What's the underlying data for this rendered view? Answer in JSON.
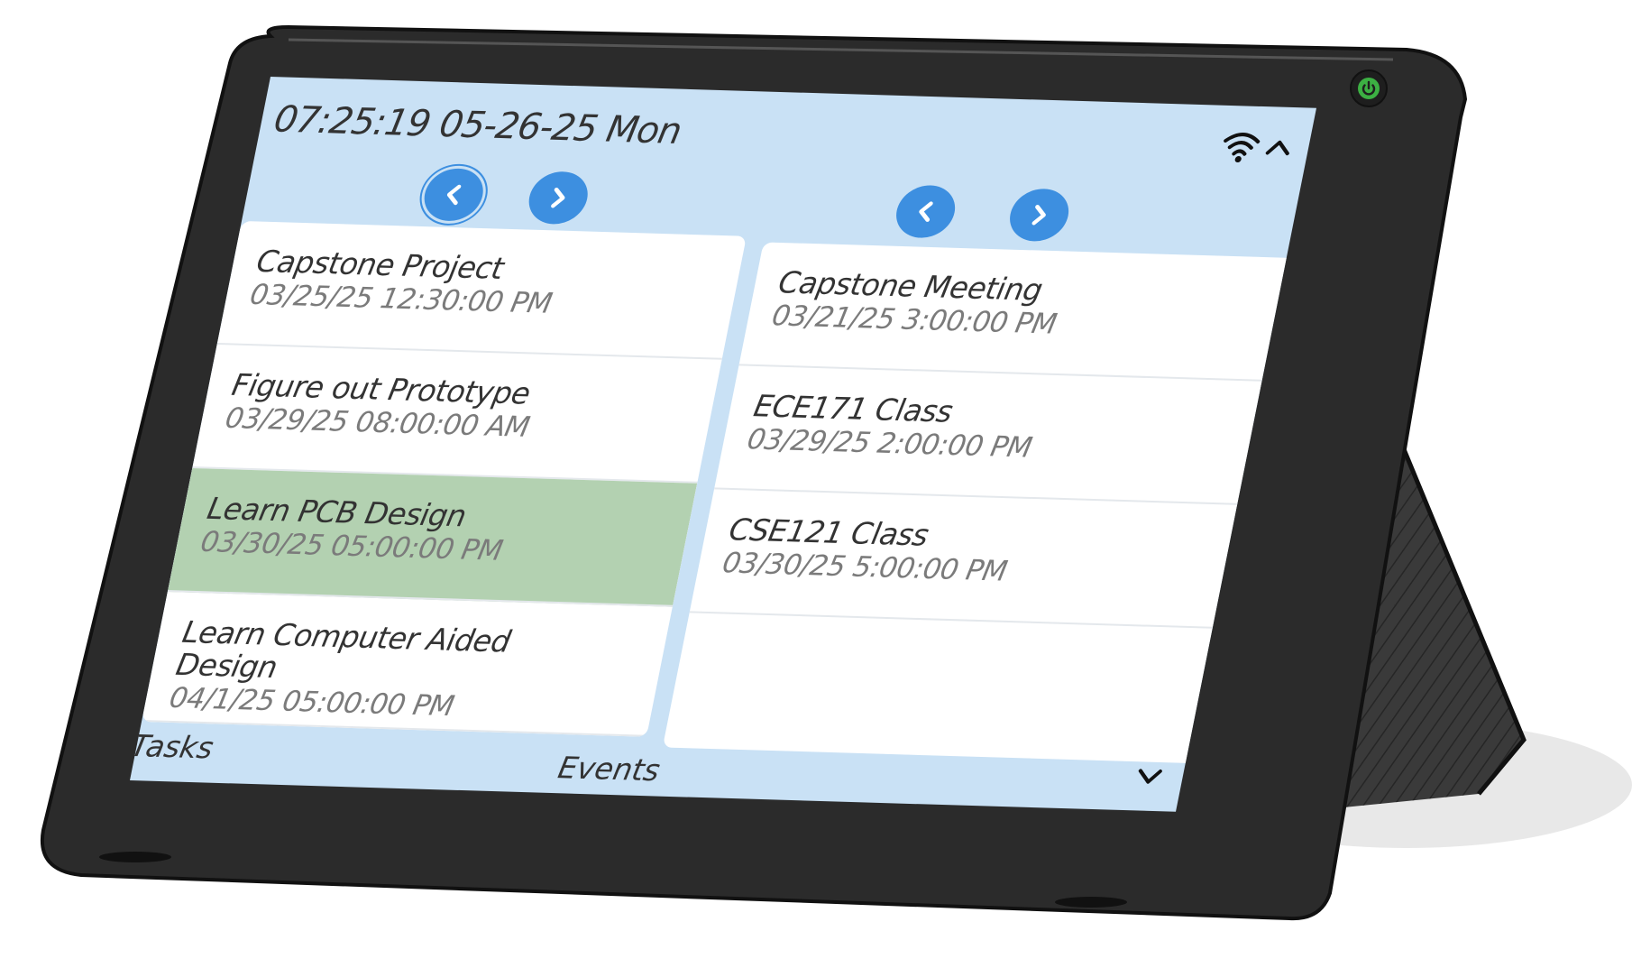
{
  "header": {
    "clock": "07:25:19 05-26-25 Mon",
    "wifi_icon": "wifi-icon",
    "collapse_icon": "chevron-up-icon"
  },
  "tasks": {
    "label": "Tasks",
    "prev_icon": "chevron-left-icon",
    "next_icon": "chevron-right-icon",
    "items": [
      {
        "title": "Capstone Project",
        "date": "03/25/25 12:30:00 PM"
      },
      {
        "title": "Figure out Prototype",
        "date": "03/29/25 08:00:00 AM"
      },
      {
        "title": "Learn PCB Design",
        "date": "03/30/25 05:00:00 PM",
        "selected": true
      },
      {
        "title": "Learn Computer Aided Design",
        "date": "04/1/25 05:00:00 PM"
      }
    ]
  },
  "events": {
    "label": "Events",
    "prev_icon": "chevron-left-icon",
    "next_icon": "chevron-right-icon",
    "items": [
      {
        "title": "Capstone Meeting",
        "date": "03/21/25 3:00:00 PM"
      },
      {
        "title": "ECE171 Class",
        "date": "03/29/25 2:00:00 PM"
      },
      {
        "title": "CSE121 Class",
        "date": "03/30/25 5:00:00 PM"
      }
    ]
  },
  "footer": {
    "expand_icon": "chevron-down-icon"
  },
  "device": {
    "power_icon": "power-icon"
  },
  "colors": {
    "screen_bg": "#c9e1f5",
    "accent_blue": "#3d8fe0",
    "selected_row": "#b3d1b1",
    "bezel": "#2b2b2b",
    "power_led": "#3cb043"
  }
}
